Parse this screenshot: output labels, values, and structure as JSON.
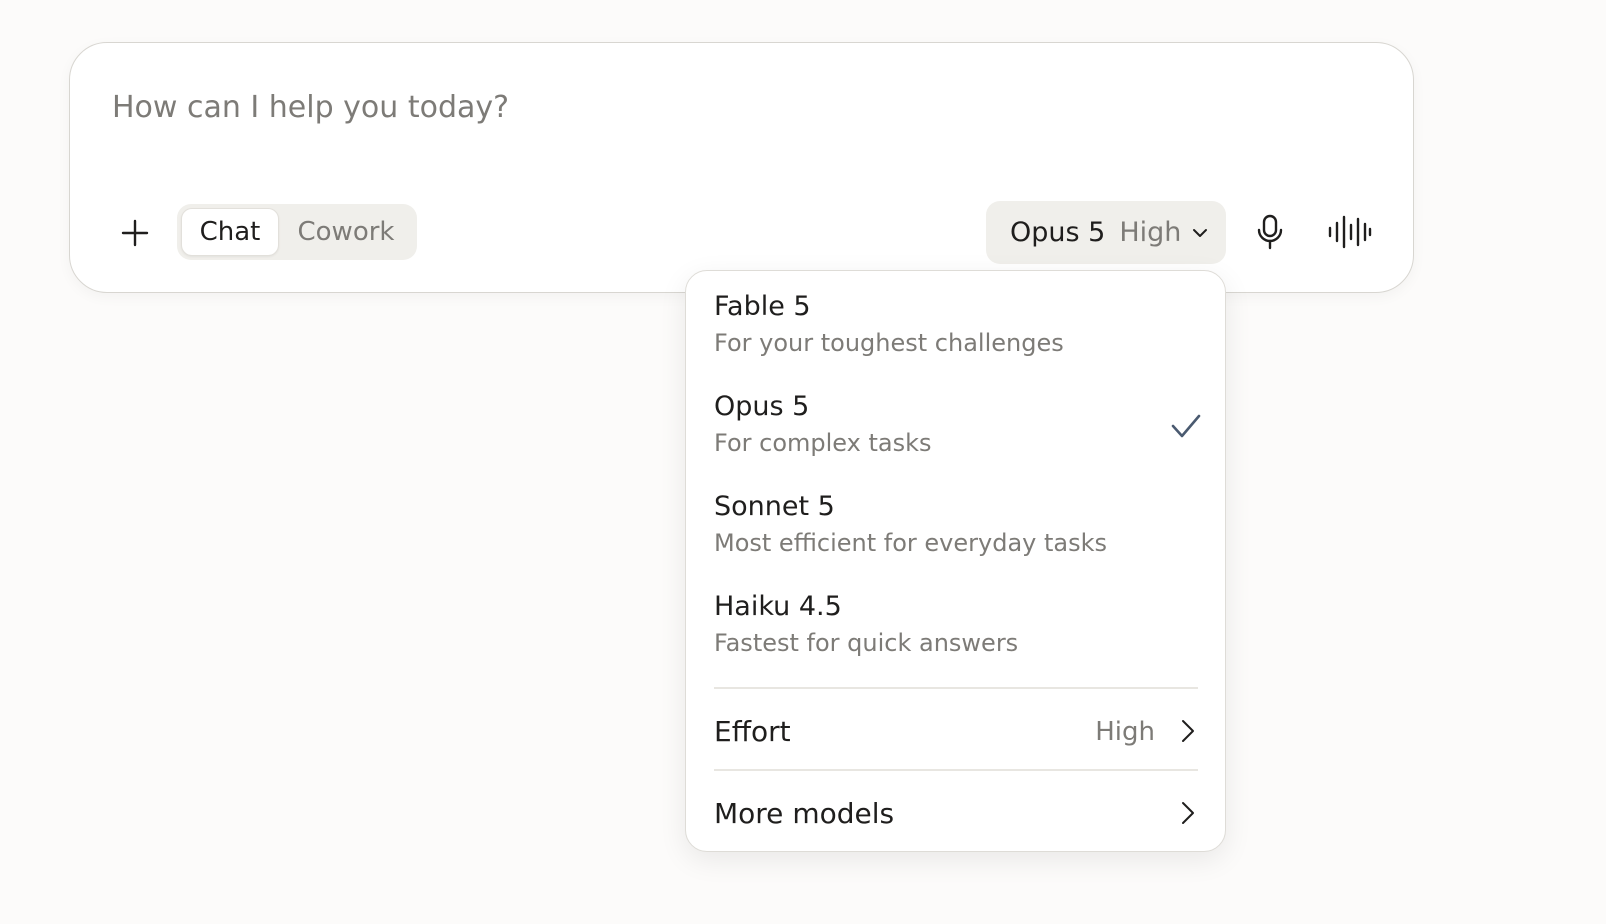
{
  "composer": {
    "placeholder": "How can I help you today?",
    "modes": [
      {
        "label": "Chat",
        "active": true
      },
      {
        "label": "Cowork",
        "active": false
      }
    ],
    "model_selector": {
      "model": "Opus 5",
      "effort": "High"
    },
    "icons": [
      "plus-icon",
      "microphone-icon",
      "voice-waveform-icon"
    ]
  },
  "dropdown": {
    "models": [
      {
        "name": "Fable 5",
        "description": "For your toughest challenges",
        "selected": false
      },
      {
        "name": "Opus 5",
        "description": "For complex tasks",
        "selected": true
      },
      {
        "name": "Sonnet 5",
        "description": "Most efficient for everyday tasks",
        "selected": false
      },
      {
        "name": "Haiku 4.5",
        "description": "Fastest for quick answers",
        "selected": false
      }
    ],
    "effort": {
      "label": "Effort",
      "value": "High"
    },
    "more_models": {
      "label": "More models"
    }
  },
  "colors": {
    "background": "#fcfbfa",
    "surface": "#ffffff",
    "pill": "#f0efeb",
    "text": "#1f1e1d",
    "muted_text": "#7d7b77",
    "check": "#4a5a70"
  }
}
